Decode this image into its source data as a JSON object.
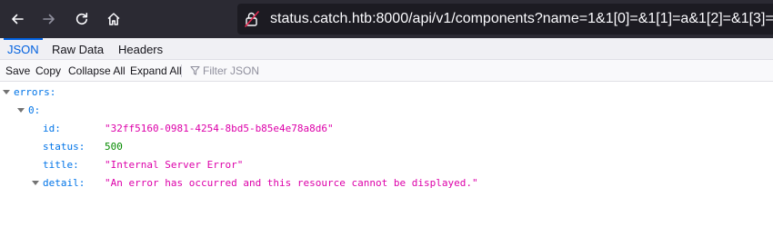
{
  "browser": {
    "url_host": "status.catch.htb",
    "url_rest": ":8000/api/v1/components?name=1&1[0]=&1[1]=a&1[2]=&1[3]="
  },
  "viewer": {
    "tabs": [
      "JSON",
      "Raw Data",
      "Headers"
    ],
    "toolbar": {
      "save": "Save",
      "copy": "Copy",
      "collapse_all": "Collapse All",
      "expand_all": "Expand All",
      "filter_placeholder": "Filter JSON"
    }
  },
  "json": {
    "root_key": "errors:",
    "index_key": "0:",
    "fields": [
      {
        "key": "id:",
        "value": "\"32ff5160-0981-4254-8bd5-b85e4e78a8d6\"",
        "type": "string"
      },
      {
        "key": "status:",
        "value": "500",
        "type": "number"
      },
      {
        "key": "title:",
        "value": "\"Internal Server Error\"",
        "type": "string"
      },
      {
        "key": "detail:",
        "value": "\"An error has occurred and this resource cannot be displayed.\"",
        "type": "string"
      }
    ]
  },
  "colors": {
    "toolbar_bg": "#2b2a33",
    "url_bg": "#1c1b22",
    "accent": "#0060df",
    "json_key": "#0074e8",
    "json_string": "#dd00a9",
    "json_number": "#058b00"
  }
}
